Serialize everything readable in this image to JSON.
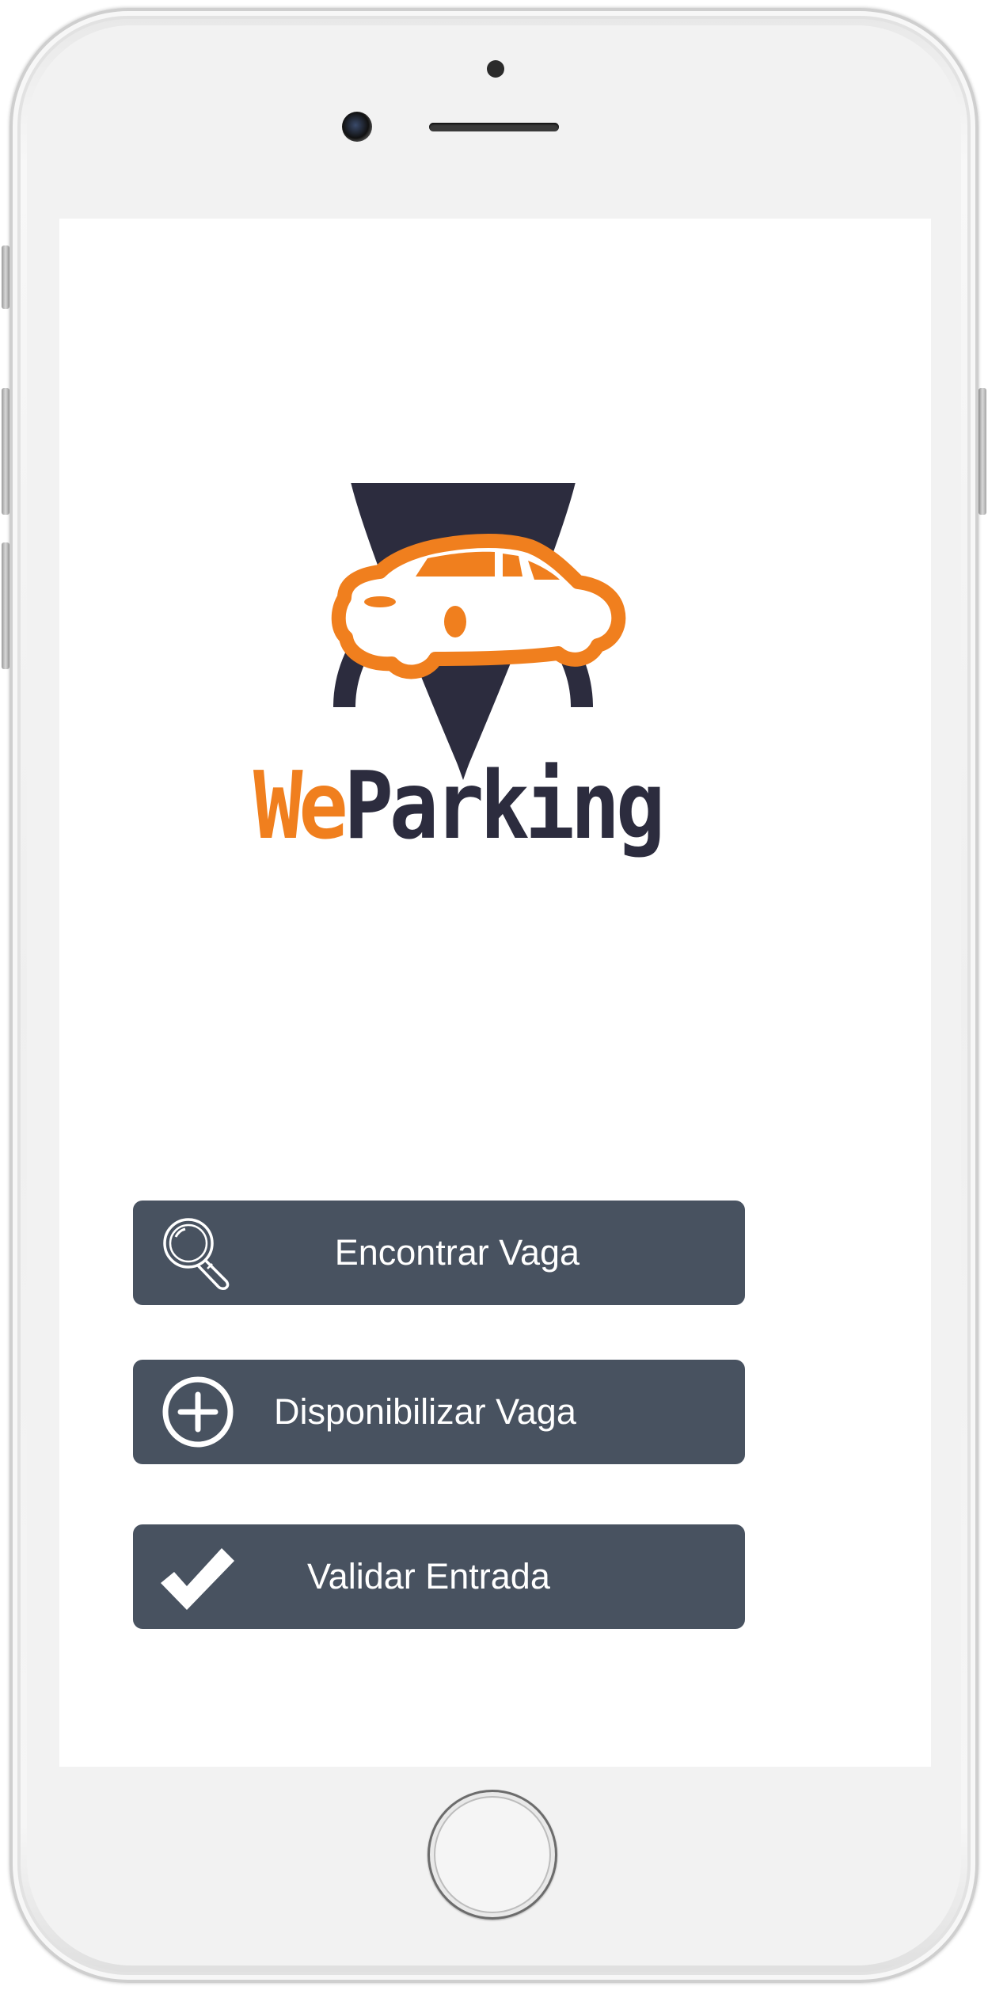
{
  "app": {
    "brand_we": "We",
    "brand_parking": "Parking"
  },
  "colors": {
    "orange": "#f07f1e",
    "dark": "#2c2c3e",
    "button_bg": "#485260",
    "button_text": "#ffffff"
  },
  "actions": [
    {
      "label": "Encontrar Vaga",
      "icon": "search-icon"
    },
    {
      "label": "Disponibilizar Vaga",
      "icon": "plus-circle-icon"
    },
    {
      "label": "Validar Entrada",
      "icon": "check-icon"
    }
  ]
}
